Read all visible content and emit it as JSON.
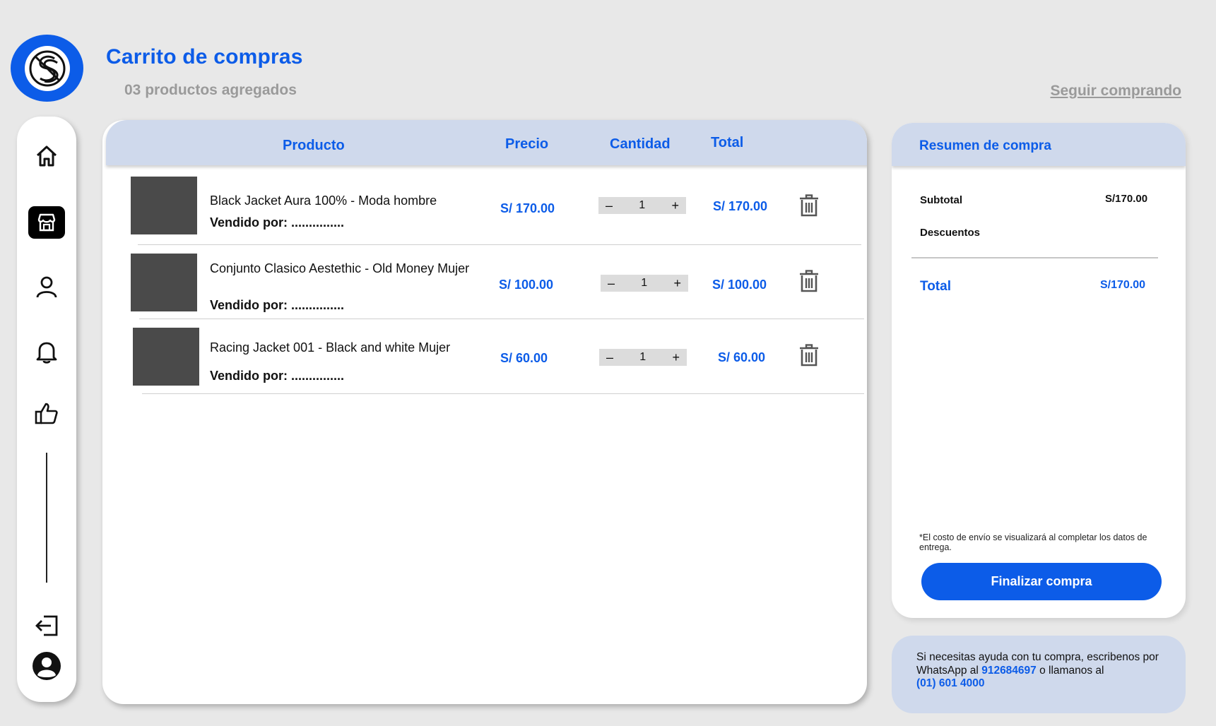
{
  "header": {
    "title": "Carrito de compras",
    "subtitle": "03 productos agregados",
    "keep_shopping": "Seguir comprando"
  },
  "sidebar": {
    "items": [
      {
        "icon": "home-icon"
      },
      {
        "icon": "store-icon",
        "active": true
      },
      {
        "icon": "user-icon"
      },
      {
        "icon": "bell-icon"
      },
      {
        "icon": "thumbs-up-icon"
      },
      {
        "icon": "logout-icon"
      },
      {
        "icon": "account-icon"
      }
    ]
  },
  "cart": {
    "columns": {
      "product": "Producto",
      "price": "Precio",
      "quantity": "Cantidad",
      "total": "Total"
    },
    "items": [
      {
        "name": "Black Jacket Aura 100% - Moda hombre",
        "seller": "Vendido por: ...............",
        "price": "S/ 170.00",
        "qty": "1",
        "total": "S/ 170.00"
      },
      {
        "name": "Conjunto Clasico Aestethic - Old Money Mujer",
        "seller": "Vendido por: ...............",
        "price": "S/ 100.00",
        "qty": "1",
        "total": "S/ 100.00"
      },
      {
        "name": "Racing Jacket 001 - Black and white Mujer",
        "seller": "Vendido por: ...............",
        "price": "S/ 60.00",
        "qty": "1",
        "total": "S/ 60.00"
      }
    ],
    "minus": "–",
    "plus": "+"
  },
  "summary": {
    "title": "Resumen de compra",
    "subtotal_label": "Subtotal",
    "subtotal_value": "S/170.00",
    "discounts_label": "Descuentos",
    "total_label": "Total",
    "total_value": "S/170.00",
    "shipping_note": "*El costo de envío se visualizará al completar los datos de entrega.",
    "checkout_button": "Finalizar compra"
  },
  "help": {
    "text_1": "Si necesitas ayuda con tu compra, escribenos por WhatsApp al",
    "whatsapp": "912684697",
    "text_2": "o llamanos al",
    "phone": "(01) 601 4000"
  },
  "colors": {
    "accent": "#0c5ce8",
    "header_bg": "#cfd9ec",
    "background": "#e8e8e8"
  }
}
